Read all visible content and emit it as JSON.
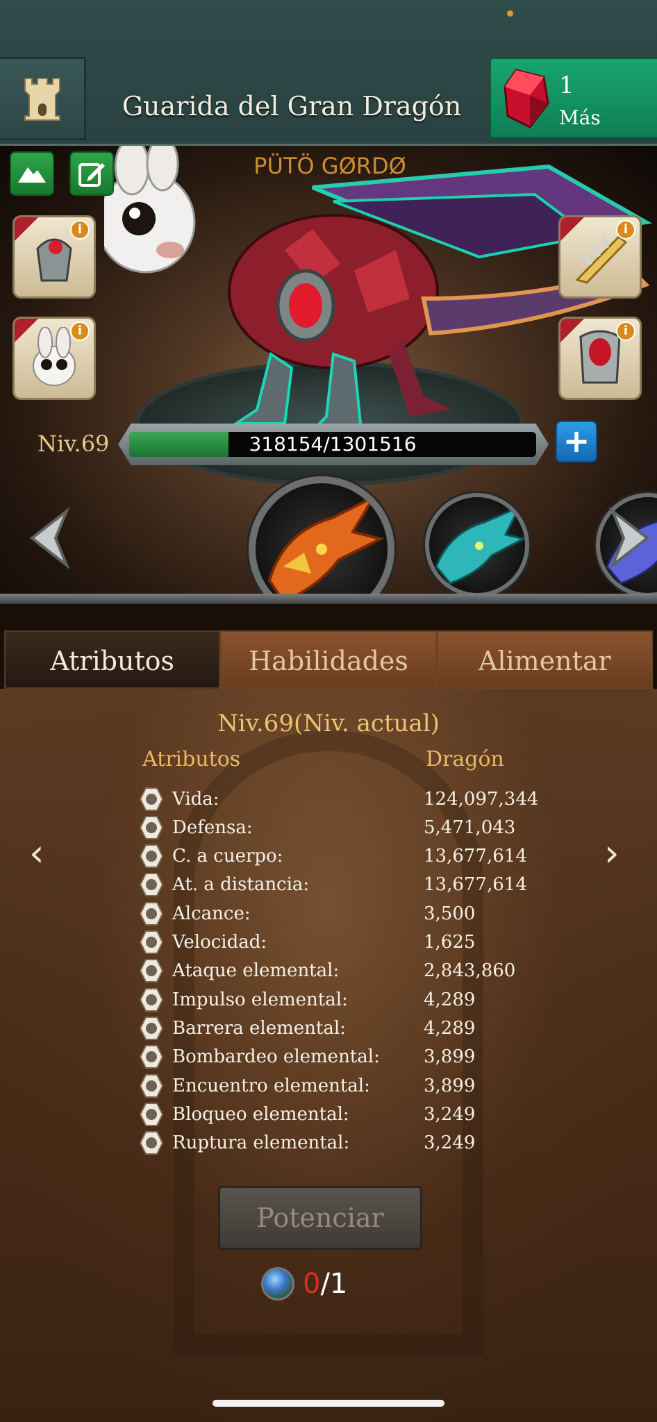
{
  "header": {
    "title": "Guarida del Gran Dragón",
    "gems": {
      "count": "1",
      "more_label": "Más",
      "icon": "ruby-gem-icon"
    },
    "castle_icon": "tower-icon"
  },
  "scene": {
    "dragon_name": "PÜTÖ GØRDØ",
    "left_buttons": [
      {
        "icon": "mountain-icon"
      },
      {
        "icon": "edit-icon"
      }
    ],
    "left_slots": [
      {
        "icon": "armor-helm-icon",
        "badge": "i"
      },
      {
        "icon": "bunny-head-icon",
        "badge": "i"
      }
    ],
    "right_slots": [
      {
        "icon": "claw-blade-icon",
        "badge": "i"
      },
      {
        "icon": "chest-armor-icon",
        "badge": "i"
      }
    ],
    "level": "Niv.69",
    "xp": {
      "text": "318154/1301516",
      "current": 318154,
      "max": 1301516
    },
    "xp_plus": "+"
  },
  "tabs": [
    {
      "label": "Atributos",
      "active": true
    },
    {
      "label": "Habilidades",
      "active": false
    },
    {
      "label": "Alimentar",
      "active": false
    }
  ],
  "attributes": {
    "level_heading": "Niv.69(Niv. actual)",
    "col_attr": "Atributos",
    "col_dragon": "Dragón",
    "rows": [
      {
        "label": "Vida:",
        "value": "124,097,344",
        "icon": "heart-icon"
      },
      {
        "label": "Defensa:",
        "value": "5,471,043",
        "icon": "shield-icon"
      },
      {
        "label": "C. a cuerpo:",
        "value": "13,677,614",
        "icon": "sword-icon"
      },
      {
        "label": "At. a distancia:",
        "value": "13,677,614",
        "icon": "bow-icon"
      },
      {
        "label": "Alcance:",
        "value": "3,500",
        "icon": "target-icon"
      },
      {
        "label": "Velocidad:",
        "value": "1,625",
        "icon": "boot-icon"
      },
      {
        "label": "Ataque elemental:",
        "value": "2,843,860",
        "icon": "burst-icon"
      },
      {
        "label": "Impulso elemental:",
        "value": "4,289",
        "icon": "impulse-icon"
      },
      {
        "label": "Barrera elemental:",
        "value": "4,289",
        "icon": "barrier-icon"
      },
      {
        "label": "Bombardeo elemental:",
        "value": "3,899",
        "icon": "bomb-icon"
      },
      {
        "label": "Encuentro elemental:",
        "value": "3,899",
        "icon": "encounter-icon"
      },
      {
        "label": "Bloqueo elemental:",
        "value": "3,249",
        "icon": "fist-icon"
      },
      {
        "label": "Ruptura elemental:",
        "value": "3,249",
        "icon": "rupture-icon"
      }
    ],
    "prev_arrow": "‹",
    "next_arrow": "›"
  },
  "power": {
    "button_label": "Potenciar",
    "have": "0",
    "need": "/1",
    "icon": "orb-icon"
  }
}
